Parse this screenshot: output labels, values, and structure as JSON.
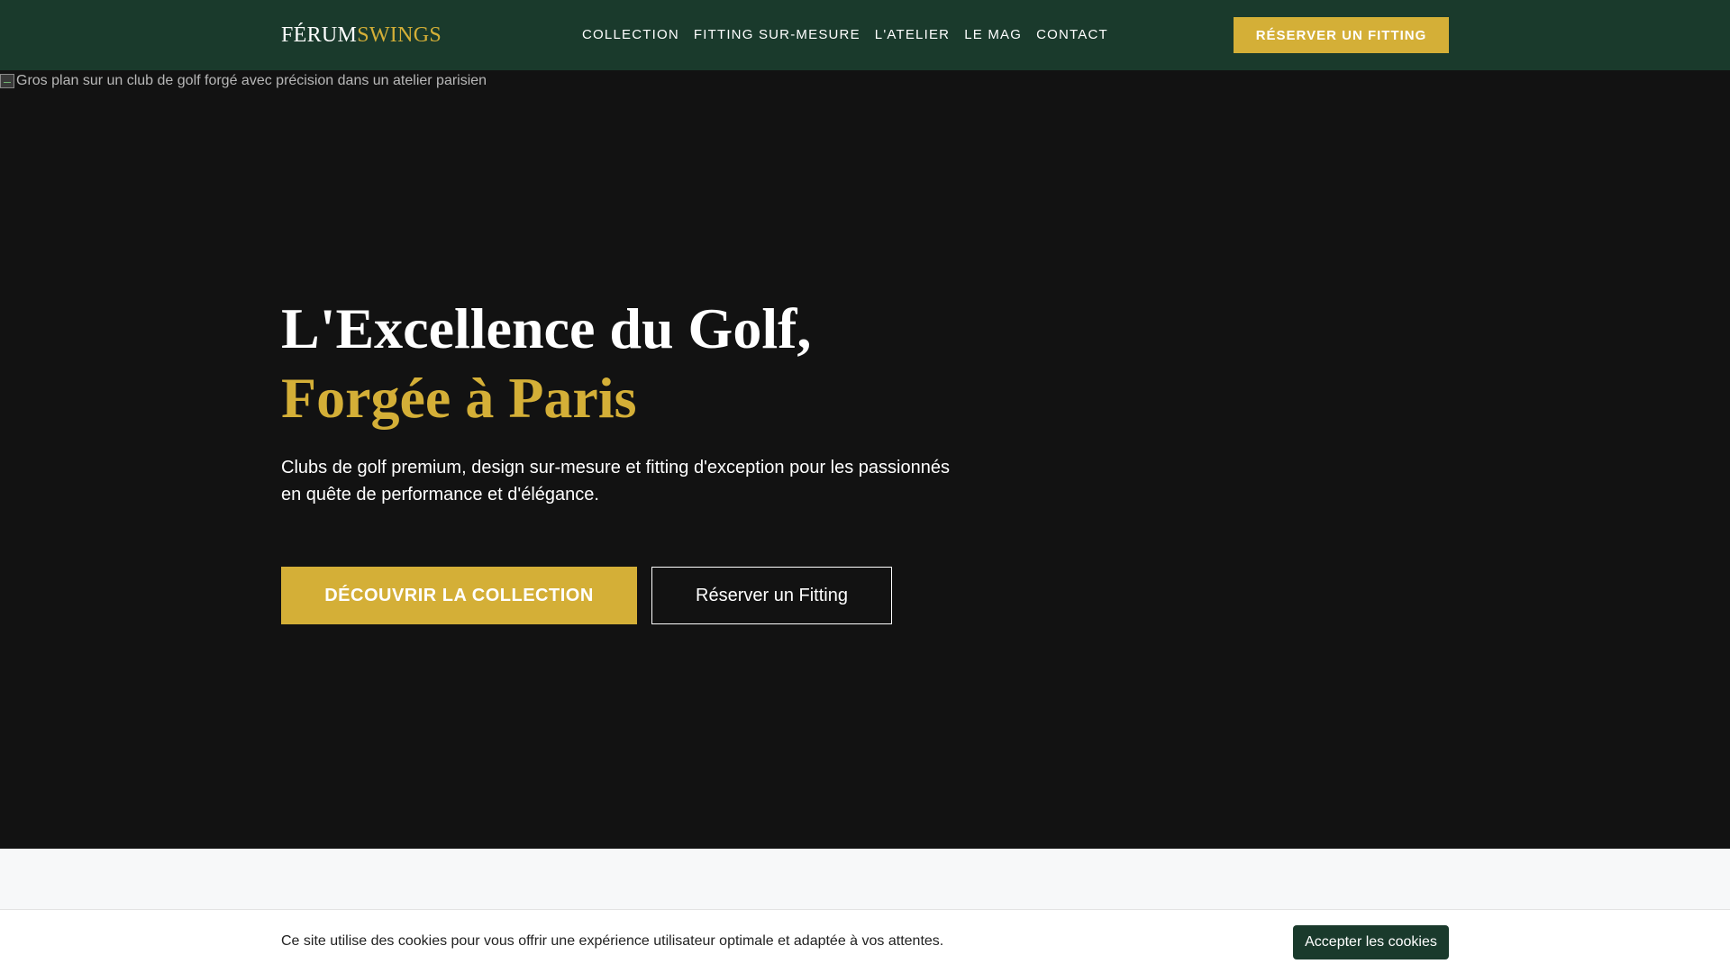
{
  "brand": {
    "name_part1": "FÉRUM",
    "name_part2": "SWINGS",
    "colors": {
      "primary": "#1a3a2c",
      "accent": "#d4af37",
      "hero_bg": "#121212"
    }
  },
  "nav": {
    "items": [
      {
        "label": "COLLECTION"
      },
      {
        "label": "FITTING SUR-MESURE"
      },
      {
        "label": "L'ATELIER"
      },
      {
        "label": "LE MAG"
      },
      {
        "label": "CONTACT"
      }
    ],
    "cta_label": "RÉSERVER UN FITTING"
  },
  "hero": {
    "image_alt": "Gros plan sur un club de golf forgé avec précision dans un atelier parisien",
    "title_line1": "L'Excellence du Golf,",
    "title_line2": "Forgée à Paris",
    "subtitle": "Clubs de golf premium, design sur-mesure et fitting d'exception pour les passionnés en quête de performance et d'élégance.",
    "primary_button": "DÉCOUVRIR LA COLLECTION",
    "secondary_button": "Réserver un Fitting"
  },
  "cookie": {
    "text": "Ce site utilise des cookies pour vous offrir une expérience utilisateur optimale et adaptée à vos attentes.",
    "button": "Accepter les cookies"
  }
}
